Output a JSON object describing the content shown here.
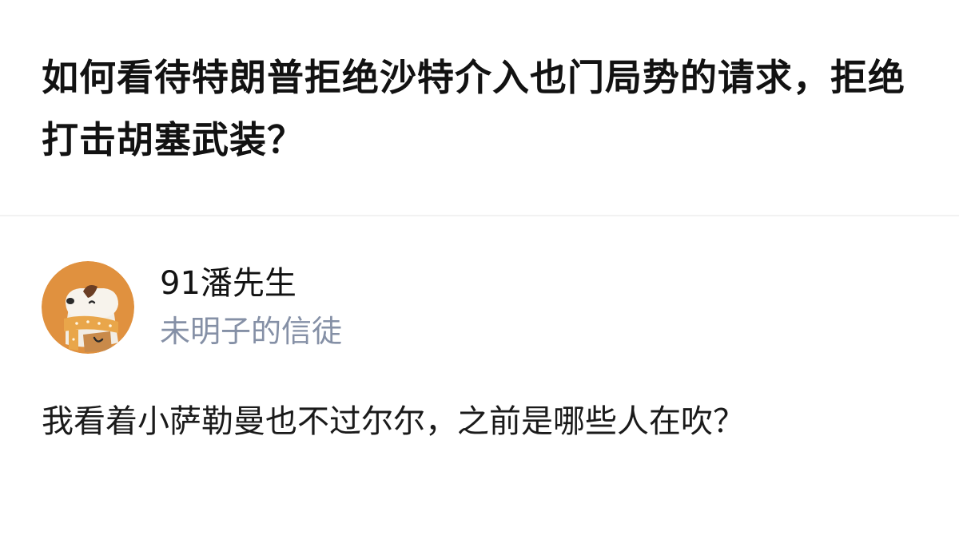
{
  "question": {
    "title": "如何看待特朗普拒绝沙特介入也门局势的请求，拒绝打击胡塞武装？"
  },
  "answer": {
    "author": {
      "name": "91潘先生",
      "headline": "未明子的信徒",
      "avatar_icon": "dog-avatar-icon"
    },
    "content": "我看着小萨勒曼也不过尔尔，之前是哪些人在吹？"
  },
  "colors": {
    "title": "#121212",
    "headline": "#8590a6",
    "avatar_bg": "#e0913f",
    "divider": "#f2f2f2"
  }
}
